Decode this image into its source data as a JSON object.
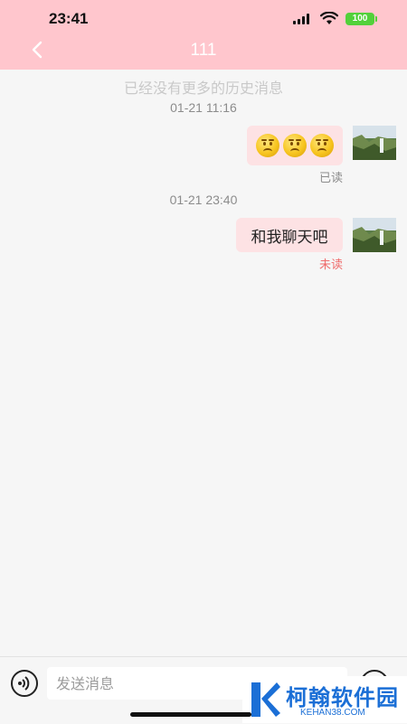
{
  "status_bar": {
    "time": "23:41",
    "battery": "100"
  },
  "header": {
    "title": "111",
    "back_icon": "chevron-left-icon"
  },
  "chat": {
    "history_notice": "已经没有更多的历史消息",
    "messages": [
      {
        "timestamp": "01-21 11:16",
        "type": "emoji",
        "emoji_count": 3,
        "emoji_icon": "confused-face-emoji",
        "status": "已读"
      },
      {
        "timestamp": "01-21 23:40",
        "type": "text",
        "text": "和我聊天吧",
        "status": "未读"
      }
    ]
  },
  "input_bar": {
    "placeholder": "发送消息",
    "value": "",
    "voice_icon": "voice-icon",
    "emoji_icon": "emoji-icon"
  },
  "watermark": {
    "name": "柯翰软件园",
    "url": "KEHAN38.COM"
  },
  "colors": {
    "header_bg": "#ffc6cd",
    "bubble_bg": "#fde2e4",
    "unread": "#ef6c6c",
    "battery": "#52d13a",
    "brand_blue": "#1b6fd6"
  }
}
